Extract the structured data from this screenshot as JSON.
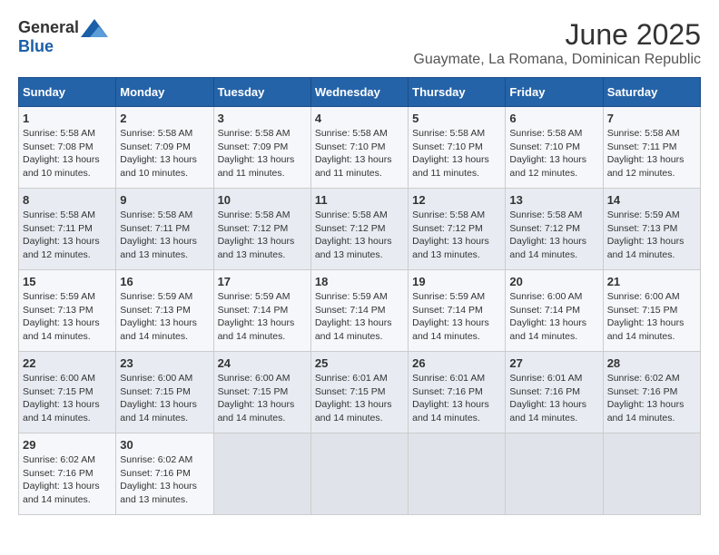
{
  "logo": {
    "general": "General",
    "blue": "Blue"
  },
  "title": "June 2025",
  "location": "Guaymate, La Romana, Dominican Republic",
  "days_of_week": [
    "Sunday",
    "Monday",
    "Tuesday",
    "Wednesday",
    "Thursday",
    "Friday",
    "Saturday"
  ],
  "weeks": [
    [
      {
        "day": "1",
        "lines": [
          "Sunrise: 5:58 AM",
          "Sunset: 7:08 PM",
          "Daylight: 13 hours",
          "and 10 minutes."
        ]
      },
      {
        "day": "2",
        "lines": [
          "Sunrise: 5:58 AM",
          "Sunset: 7:09 PM",
          "Daylight: 13 hours",
          "and 10 minutes."
        ]
      },
      {
        "day": "3",
        "lines": [
          "Sunrise: 5:58 AM",
          "Sunset: 7:09 PM",
          "Daylight: 13 hours",
          "and 11 minutes."
        ]
      },
      {
        "day": "4",
        "lines": [
          "Sunrise: 5:58 AM",
          "Sunset: 7:10 PM",
          "Daylight: 13 hours",
          "and 11 minutes."
        ]
      },
      {
        "day": "5",
        "lines": [
          "Sunrise: 5:58 AM",
          "Sunset: 7:10 PM",
          "Daylight: 13 hours",
          "and 11 minutes."
        ]
      },
      {
        "day": "6",
        "lines": [
          "Sunrise: 5:58 AM",
          "Sunset: 7:10 PM",
          "Daylight: 13 hours",
          "and 12 minutes."
        ]
      },
      {
        "day": "7",
        "lines": [
          "Sunrise: 5:58 AM",
          "Sunset: 7:11 PM",
          "Daylight: 13 hours",
          "and 12 minutes."
        ]
      }
    ],
    [
      {
        "day": "8",
        "lines": [
          "Sunrise: 5:58 AM",
          "Sunset: 7:11 PM",
          "Daylight: 13 hours",
          "and 12 minutes."
        ]
      },
      {
        "day": "9",
        "lines": [
          "Sunrise: 5:58 AM",
          "Sunset: 7:11 PM",
          "Daylight: 13 hours",
          "and 13 minutes."
        ]
      },
      {
        "day": "10",
        "lines": [
          "Sunrise: 5:58 AM",
          "Sunset: 7:12 PM",
          "Daylight: 13 hours",
          "and 13 minutes."
        ]
      },
      {
        "day": "11",
        "lines": [
          "Sunrise: 5:58 AM",
          "Sunset: 7:12 PM",
          "Daylight: 13 hours",
          "and 13 minutes."
        ]
      },
      {
        "day": "12",
        "lines": [
          "Sunrise: 5:58 AM",
          "Sunset: 7:12 PM",
          "Daylight: 13 hours",
          "and 13 minutes."
        ]
      },
      {
        "day": "13",
        "lines": [
          "Sunrise: 5:58 AM",
          "Sunset: 7:12 PM",
          "Daylight: 13 hours",
          "and 14 minutes."
        ]
      },
      {
        "day": "14",
        "lines": [
          "Sunrise: 5:59 AM",
          "Sunset: 7:13 PM",
          "Daylight: 13 hours",
          "and 14 minutes."
        ]
      }
    ],
    [
      {
        "day": "15",
        "lines": [
          "Sunrise: 5:59 AM",
          "Sunset: 7:13 PM",
          "Daylight: 13 hours",
          "and 14 minutes."
        ]
      },
      {
        "day": "16",
        "lines": [
          "Sunrise: 5:59 AM",
          "Sunset: 7:13 PM",
          "Daylight: 13 hours",
          "and 14 minutes."
        ]
      },
      {
        "day": "17",
        "lines": [
          "Sunrise: 5:59 AM",
          "Sunset: 7:14 PM",
          "Daylight: 13 hours",
          "and 14 minutes."
        ]
      },
      {
        "day": "18",
        "lines": [
          "Sunrise: 5:59 AM",
          "Sunset: 7:14 PM",
          "Daylight: 13 hours",
          "and 14 minutes."
        ]
      },
      {
        "day": "19",
        "lines": [
          "Sunrise: 5:59 AM",
          "Sunset: 7:14 PM",
          "Daylight: 13 hours",
          "and 14 minutes."
        ]
      },
      {
        "day": "20",
        "lines": [
          "Sunrise: 6:00 AM",
          "Sunset: 7:14 PM",
          "Daylight: 13 hours",
          "and 14 minutes."
        ]
      },
      {
        "day": "21",
        "lines": [
          "Sunrise: 6:00 AM",
          "Sunset: 7:15 PM",
          "Daylight: 13 hours",
          "and 14 minutes."
        ]
      }
    ],
    [
      {
        "day": "22",
        "lines": [
          "Sunrise: 6:00 AM",
          "Sunset: 7:15 PM",
          "Daylight: 13 hours",
          "and 14 minutes."
        ]
      },
      {
        "day": "23",
        "lines": [
          "Sunrise: 6:00 AM",
          "Sunset: 7:15 PM",
          "Daylight: 13 hours",
          "and 14 minutes."
        ]
      },
      {
        "day": "24",
        "lines": [
          "Sunrise: 6:00 AM",
          "Sunset: 7:15 PM",
          "Daylight: 13 hours",
          "and 14 minutes."
        ]
      },
      {
        "day": "25",
        "lines": [
          "Sunrise: 6:01 AM",
          "Sunset: 7:15 PM",
          "Daylight: 13 hours",
          "and 14 minutes."
        ]
      },
      {
        "day": "26",
        "lines": [
          "Sunrise: 6:01 AM",
          "Sunset: 7:16 PM",
          "Daylight: 13 hours",
          "and 14 minutes."
        ]
      },
      {
        "day": "27",
        "lines": [
          "Sunrise: 6:01 AM",
          "Sunset: 7:16 PM",
          "Daylight: 13 hours",
          "and 14 minutes."
        ]
      },
      {
        "day": "28",
        "lines": [
          "Sunrise: 6:02 AM",
          "Sunset: 7:16 PM",
          "Daylight: 13 hours",
          "and 14 minutes."
        ]
      }
    ],
    [
      {
        "day": "29",
        "lines": [
          "Sunrise: 6:02 AM",
          "Sunset: 7:16 PM",
          "Daylight: 13 hours",
          "and 14 minutes."
        ]
      },
      {
        "day": "30",
        "lines": [
          "Sunrise: 6:02 AM",
          "Sunset: 7:16 PM",
          "Daylight: 13 hours",
          "and 13 minutes."
        ]
      },
      {
        "day": "",
        "lines": []
      },
      {
        "day": "",
        "lines": []
      },
      {
        "day": "",
        "lines": []
      },
      {
        "day": "",
        "lines": []
      },
      {
        "day": "",
        "lines": []
      }
    ]
  ]
}
